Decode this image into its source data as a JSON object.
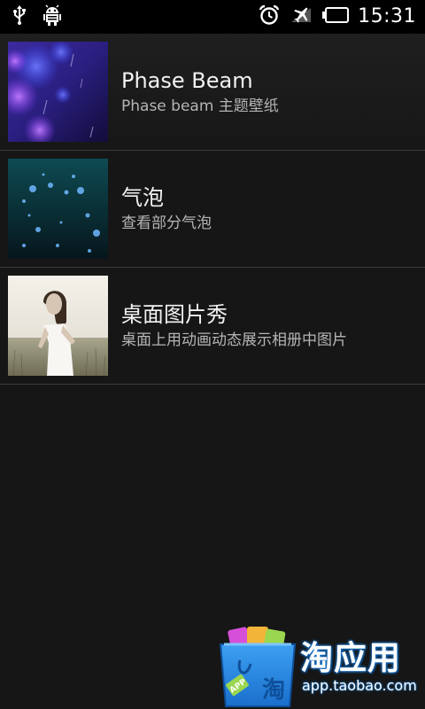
{
  "status_bar": {
    "time": "15:31",
    "icons": [
      "usb-icon",
      "android-debug-icon",
      "alarm-icon",
      "airplane-mode-icon",
      "battery-icon"
    ]
  },
  "wallpapers": [
    {
      "title": "Phase Beam",
      "subtitle": "Phase beam 主题壁纸"
    },
    {
      "title": "气泡",
      "subtitle": "查看部分气泡"
    },
    {
      "title": "桌面图片秀",
      "subtitle": "桌面上用动画动态展示相册中图片"
    }
  ],
  "watermark": {
    "text": "淘应用",
    "url": "app.taobao.com",
    "bag_label": "APP",
    "bag_char": "淘"
  },
  "colors": {
    "background": "#161616",
    "divider": "#3a3a3a",
    "title": "#f2f2f2",
    "subtitle": "#b5b5b5",
    "watermark_blue": "#1a75c9"
  }
}
